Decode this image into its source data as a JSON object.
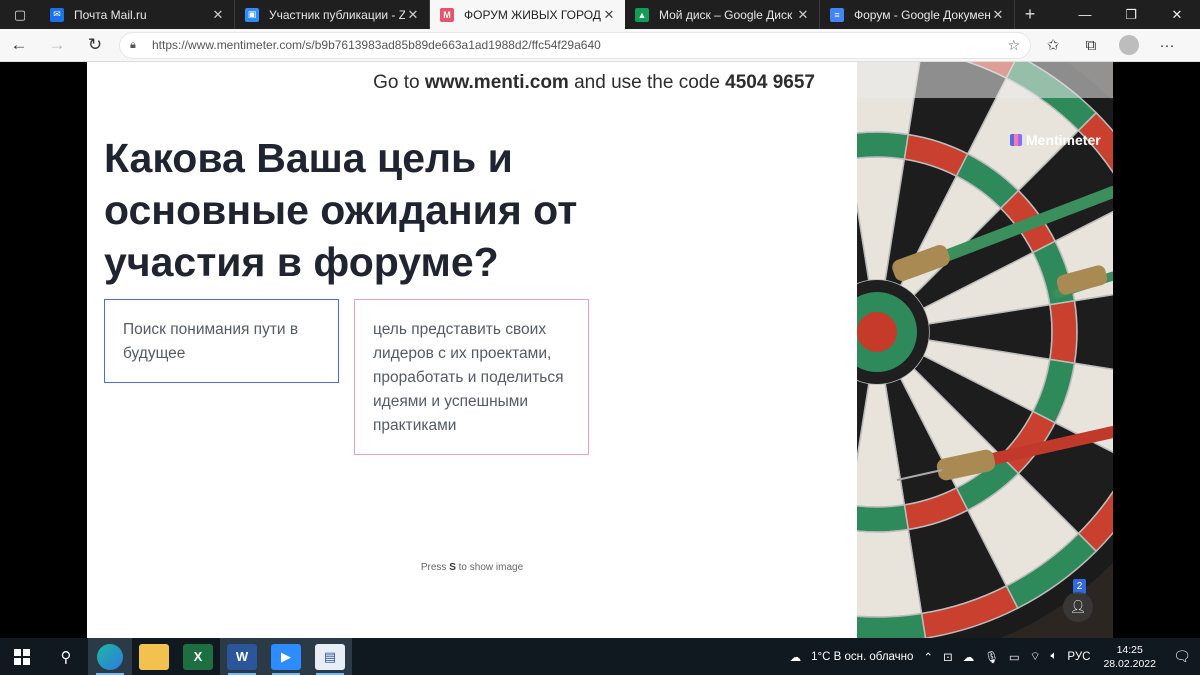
{
  "browser": {
    "tabs": [
      {
        "title": "Почта Mail.ru",
        "favicon_color": "#1a73e8",
        "favicon_glyph": "✉",
        "active": false
      },
      {
        "title": "Участник публикации - Zoom",
        "favicon_color": "#2d8cff",
        "favicon_glyph": "▣",
        "active": false
      },
      {
        "title": "ФОРУМ ЖИВЫХ ГОРОДОВ - Ментиметр",
        "favicon_color": "#e8536c",
        "favicon_glyph": "M",
        "active": true
      },
      {
        "title": "Мой диск – Google Диск",
        "favicon_color": "#0f9d58",
        "favicon_glyph": "▲",
        "active": false
      },
      {
        "title": "Форум - Google Документы",
        "favicon_color": "#4285f4",
        "favicon_glyph": "≡",
        "active": false
      }
    ],
    "url": "https://www.mentimeter.com/s/b9b7613983ad85b89de663a1ad1988d2/ffc54f29a640"
  },
  "slide": {
    "code_prefix": "Go to ",
    "code_site": "www.menti.com",
    "code_middle": " and use the code ",
    "code_value": "4504 9657",
    "question": "Какова Ваша цель и основные ожидания от участия в форуме?",
    "responses": [
      {
        "text": "Поиск понимания пути в будущее",
        "border_color": "#4b6fd6"
      },
      {
        "text": "цель представить своих лидеров с их проектами, проработать и поделиться идеями и успешными практиками",
        "border_color": "#e9a0c0"
      }
    ],
    "press_hint_prefix": "Press ",
    "press_hint_key": "S",
    "press_hint_suffix": " to show image",
    "brand": "Mentimeter",
    "participants_badge": "2"
  },
  "taskbar": {
    "weather": "1°C  В осн. облачно",
    "language": "РУС",
    "time": "14:25",
    "date": "28.02.2022"
  }
}
